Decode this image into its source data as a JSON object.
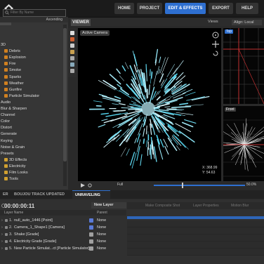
{
  "nav": {
    "items": [
      {
        "label": "HOME",
        "active": false
      },
      {
        "label": "PROJECT",
        "active": false
      },
      {
        "label": "EDIT & EFFECTS",
        "active": true
      },
      {
        "label": "EXPORT",
        "active": false
      },
      {
        "label": "HELP",
        "active": false
      }
    ]
  },
  "left_panel": {
    "tabs": [
      "ECTS",
      "TEXT",
      "HISTORY"
    ],
    "search_placeholder": "Filter By Name",
    "sort_label": "Ascending",
    "items": [
      {
        "label": "3D",
        "level": 0,
        "icon_color": ""
      },
      {
        "label": "Debris",
        "level": 1,
        "icon_color": "#d08020"
      },
      {
        "label": "Explosion",
        "level": 1,
        "icon_color": "#d08020"
      },
      {
        "label": "Fire",
        "level": 1,
        "icon_color": "#d08020"
      },
      {
        "label": "Smoke",
        "level": 1,
        "icon_color": "#d08020"
      },
      {
        "label": "Sparks",
        "level": 1,
        "icon_color": "#d08020"
      },
      {
        "label": "Weather",
        "level": 1,
        "icon_color": "#d08020"
      },
      {
        "label": "Gunfire",
        "level": 1,
        "icon_color": "#d08020"
      },
      {
        "label": "Particle Simulator",
        "level": 1,
        "icon_color": "#d08020"
      },
      {
        "label": "Audio",
        "level": 0,
        "icon_color": ""
      },
      {
        "label": "Blur & Sharpen",
        "level": 0,
        "icon_color": ""
      },
      {
        "label": "Channel",
        "level": 0,
        "icon_color": ""
      },
      {
        "label": "Color",
        "level": 0,
        "icon_color": ""
      },
      {
        "label": "Distort",
        "level": 0,
        "icon_color": ""
      },
      {
        "label": "Generate",
        "level": 0,
        "icon_color": ""
      },
      {
        "label": "Keying",
        "level": 0,
        "icon_color": ""
      },
      {
        "label": "Noise & Grain",
        "level": 0,
        "icon_color": ""
      },
      {
        "label": "Presets",
        "level": 0,
        "icon_color": ""
      },
      {
        "label": "3D Effects",
        "level": 1,
        "icon_color": "#d0a030"
      },
      {
        "label": "Electricity",
        "level": 1,
        "icon_color": "#d0a030"
      },
      {
        "label": "Film Looks",
        "level": 1,
        "icon_color": "#d0a030"
      },
      {
        "label": "Tools",
        "level": 1,
        "icon_color": "#d0a030"
      }
    ]
  },
  "viewer": {
    "tab": "VIEWER",
    "views_label": "Views",
    "align_label": "Align: Local",
    "camera_label": "Active Camera",
    "top_label": "Top",
    "front_label": "Front",
    "readout_x": "368.99",
    "readout_y": "54.63",
    "zoom": "50.0%",
    "playhead_label": "Full"
  },
  "bottom": {
    "tabs": [
      "ER",
      "BOUJOU TRACK UPDATED",
      "UNRAVELING"
    ],
    "timecode": "00:00:00:11",
    "new_layer": "New Layer",
    "layer_name_header": "Layer Name",
    "parent_header": "Parent",
    "track_headers": [
      "Make Composite Shot",
      "Layer Properties",
      "Motion Blur"
    ],
    "layers": [
      {
        "num": "1.",
        "name": "null_auto_1446 [Point]",
        "color": "#5a7ad8",
        "parent": "None"
      },
      {
        "num": "2.",
        "name": "Camera_1_Shape1 [Camera]",
        "color": "#5a7ad8",
        "parent": "None"
      },
      {
        "num": "3.",
        "name": "Shake [Grade]",
        "color": "#a0a0a0",
        "parent": "None"
      },
      {
        "num": "4.",
        "name": "Electricity Grade [Grade]",
        "color": "#a0a0a0",
        "parent": "None"
      },
      {
        "num": "5.",
        "name": "New Particle Simulat...ct [Particle Simulator]",
        "color": "#a0a0a0",
        "parent": "None"
      }
    ]
  }
}
